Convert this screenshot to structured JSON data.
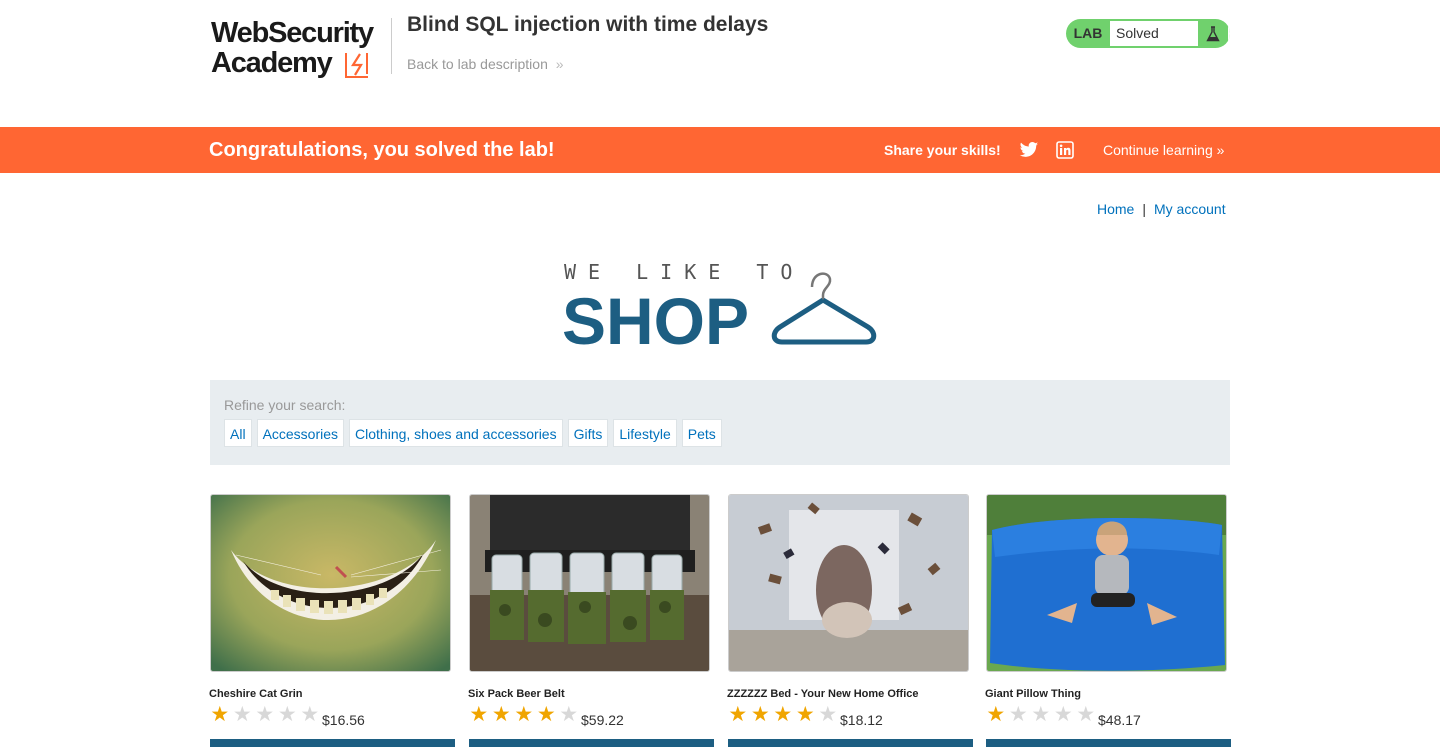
{
  "header": {
    "logo_line1": "WebSecurity",
    "logo_line2": "Academy",
    "lab_title": "Blind SQL injection with time delays",
    "back_link": "Back to lab description",
    "lab_badge": "LAB",
    "lab_status": "Solved"
  },
  "banner": {
    "message": "Congratulations, you solved the lab!",
    "share": "Share your skills!",
    "continue": "Continue learning",
    "color": "#ff6633"
  },
  "nav": {
    "home": "Home",
    "separator": "|",
    "account": "My account"
  },
  "shop_logo": {
    "tagline": "WE LIKE TO",
    "word": "SHOP"
  },
  "filter": {
    "label": "Refine your search:",
    "categories": [
      "All",
      "Accessories",
      "Clothing, shoes and accessories",
      "Gifts",
      "Lifestyle",
      "Pets"
    ]
  },
  "products": [
    {
      "name": "Cheshire Cat Grin",
      "rating": 1,
      "price": "$16.56",
      "image_icon": "cheshire-grin-image"
    },
    {
      "name": "Six Pack Beer Belt",
      "rating": 4,
      "price": "$59.22",
      "image_icon": "beer-belt-image"
    },
    {
      "name": "ZZZZZZ Bed - Your New Home Office",
      "rating": 4,
      "price": "$18.12",
      "image_icon": "flying-books-image"
    },
    {
      "name": "Giant Pillow Thing",
      "rating": 1,
      "price": "$48.17",
      "image_icon": "giant-pillow-image"
    }
  ],
  "colors": {
    "accent_orange": "#ff6633",
    "lab_green": "#70d16d",
    "link_blue": "#0071bc",
    "shop_blue": "#1d5e82",
    "star": "#f0a500"
  }
}
